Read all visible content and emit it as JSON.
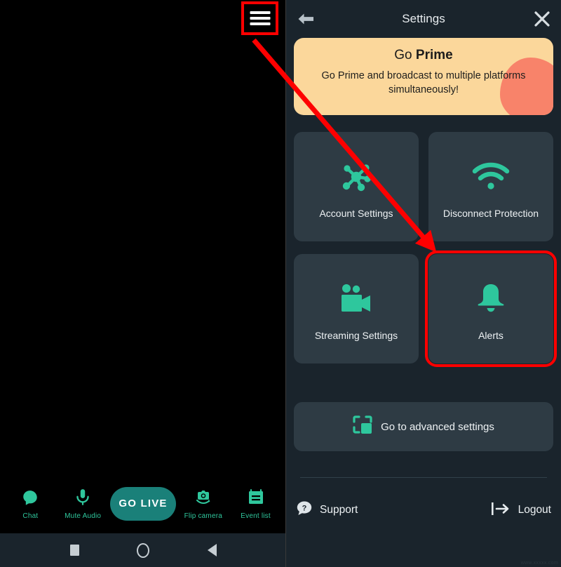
{
  "left_pane": {
    "menu_button": {
      "icon": "hamburger-menu-icon",
      "label": "Menu"
    },
    "controls": [
      {
        "id": "chat",
        "icon": "chat-bubble-icon",
        "label": "Chat"
      },
      {
        "id": "mute-audio",
        "icon": "microphone-icon",
        "label": "Mute Audio"
      },
      {
        "id": "flip-camera",
        "icon": "flip-camera-icon",
        "label": "Flip camera"
      },
      {
        "id": "event-list",
        "icon": "event-list-icon",
        "label": "Event list"
      }
    ],
    "go_live_label": "GO LIVE"
  },
  "settings_panel": {
    "header": {
      "back_icon": "back-arrow-icon",
      "title": "Settings",
      "close_icon": "close-x-icon"
    },
    "banner": {
      "title_prefix": "Go ",
      "title_strong": "Prime",
      "subtitle": "Go Prime and broadcast to multiple platforms simultaneously!",
      "background_color": "#fbd79b",
      "blob_color": "#f8836a"
    },
    "cards": [
      {
        "id": "account-settings",
        "icon": "network-nodes-icon",
        "label": "Account Settings",
        "highlighted": false
      },
      {
        "id": "disconnect-protection",
        "icon": "wifi-icon",
        "label": "Disconnect Protection",
        "highlighted": false
      },
      {
        "id": "streaming-settings",
        "icon": "video-camera-icon",
        "label": "Streaming Settings",
        "highlighted": false
      },
      {
        "id": "alerts",
        "icon": "bell-icon",
        "label": "Alerts",
        "highlighted": true
      }
    ],
    "advanced": {
      "icon": "advanced-settings-icon",
      "label": "Go to advanced settings"
    },
    "footer": {
      "support": {
        "icon": "help-bubble-icon",
        "label": "Support"
      },
      "logout": {
        "icon": "logout-arrow-icon",
        "label": "Logout"
      }
    }
  },
  "navigation_bar": {
    "recent_apps": "recent-apps-icon",
    "home": "home-icon",
    "back": "back-nav-icon"
  },
  "annotations": {
    "highlight_color": "#fe0000",
    "arrow_from": "hamburger-menu-button",
    "arrow_to": "alerts-card"
  },
  "watermark": {
    "text": "www.xxxxx.com"
  },
  "colors": {
    "accent_teal": "#2ec79d",
    "go_live_teal": "#1a8079",
    "panel_bg": "#1a242c",
    "card_bg": "#2e3b44",
    "preview_bg": "#000000",
    "text_primary": "#eef2f4"
  }
}
